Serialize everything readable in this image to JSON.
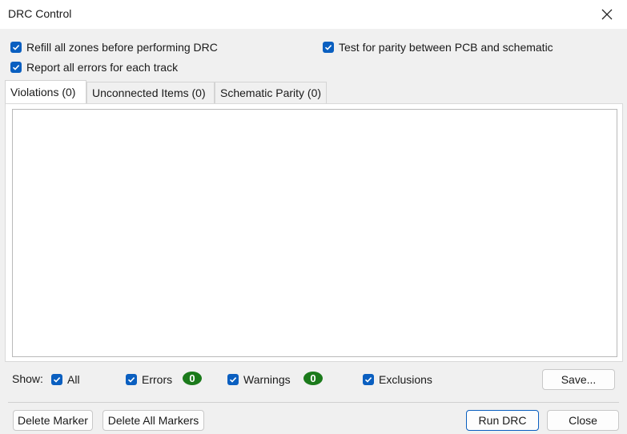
{
  "window": {
    "title": "DRC Control"
  },
  "options": {
    "refill_zones": "Refill all zones before performing DRC",
    "report_all_errors": "Report all errors for each track",
    "test_parity": "Test for parity between PCB and schematic"
  },
  "tabs": [
    {
      "label": "Violations (0)"
    },
    {
      "label": "Unconnected Items (0)"
    },
    {
      "label": "Schematic Parity (0)"
    }
  ],
  "filters": {
    "show_label": "Show:",
    "all": "All",
    "errors": "Errors",
    "errors_count": "0",
    "warnings": "Warnings",
    "warnings_count": "0",
    "exclusions": "Exclusions"
  },
  "buttons": {
    "save": "Save...",
    "delete_marker": "Delete Marker",
    "delete_all_markers": "Delete All Markers",
    "run_drc": "Run DRC",
    "close": "Close"
  },
  "colors": {
    "checkbox_accent": "#0a5fc0",
    "badge_green": "#1b7a1b"
  }
}
